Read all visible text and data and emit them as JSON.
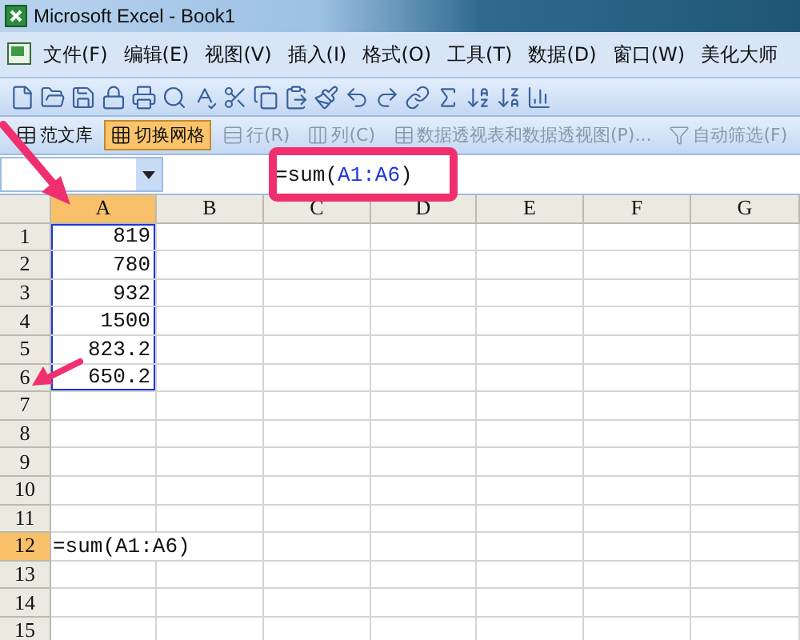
{
  "window": {
    "title": "Microsoft Excel - Book1"
  },
  "menu": [
    "文件(F)",
    "编辑(E)",
    "视图(V)",
    "插入(I)",
    "格式(O)",
    "工具(T)",
    "数据(D)",
    "窗口(W)",
    "美化大师"
  ],
  "toolbar2": [
    {
      "label": "范文库",
      "selected": false,
      "disabled": false
    },
    {
      "label": "切换网格",
      "selected": true,
      "disabled": false
    },
    {
      "label": "行(R)",
      "selected": false,
      "disabled": true
    },
    {
      "label": "列(C)",
      "selected": false,
      "disabled": true
    },
    {
      "label": "数据透视表和数据透视图(P)...",
      "selected": false,
      "disabled": true
    },
    {
      "label": "自动筛选(F)",
      "selected": false,
      "disabled": true
    }
  ],
  "formula_bar": {
    "formula_start": "=sum(",
    "formula_ref": "A1:A6",
    "formula_end": ")"
  },
  "columns": [
    {
      "label": "A",
      "selected": true
    },
    {
      "label": "B",
      "selected": false
    },
    {
      "label": "C",
      "selected": false
    },
    {
      "label": "D",
      "selected": false
    },
    {
      "label": "E",
      "selected": false
    },
    {
      "label": "F",
      "selected": false
    },
    {
      "label": "G",
      "selected": false
    }
  ],
  "rows": [
    {
      "label": "1",
      "selected": false,
      "in_range": true,
      "cells": [
        "819"
      ]
    },
    {
      "label": "2",
      "selected": false,
      "in_range": true,
      "cells": [
        "780"
      ]
    },
    {
      "label": "3",
      "selected": false,
      "in_range": true,
      "cells": [
        "932"
      ]
    },
    {
      "label": "4",
      "selected": false,
      "in_range": true,
      "cells": [
        "1500"
      ]
    },
    {
      "label": "5",
      "selected": false,
      "in_range": true,
      "cells": [
        "823.2"
      ]
    },
    {
      "label": "6",
      "selected": false,
      "in_range": true,
      "cells": [
        "650.2"
      ]
    },
    {
      "label": "7",
      "selected": false,
      "in_range": false,
      "cells": []
    },
    {
      "label": "8",
      "selected": false,
      "in_range": false,
      "cells": []
    },
    {
      "label": "9",
      "selected": false,
      "in_range": false,
      "cells": []
    },
    {
      "label": "10",
      "selected": false,
      "in_range": false,
      "cells": []
    },
    {
      "label": "11",
      "selected": false,
      "in_range": false,
      "cells": []
    },
    {
      "label": "12",
      "selected": true,
      "in_range": false,
      "cells": [
        "=sum(A1:A6)"
      ]
    },
    {
      "label": "13",
      "selected": false,
      "in_range": false,
      "cells": []
    },
    {
      "label": "14",
      "selected": false,
      "in_range": false,
      "cells": []
    },
    {
      "label": "15",
      "selected": false,
      "in_range": false,
      "cells": []
    }
  ]
}
